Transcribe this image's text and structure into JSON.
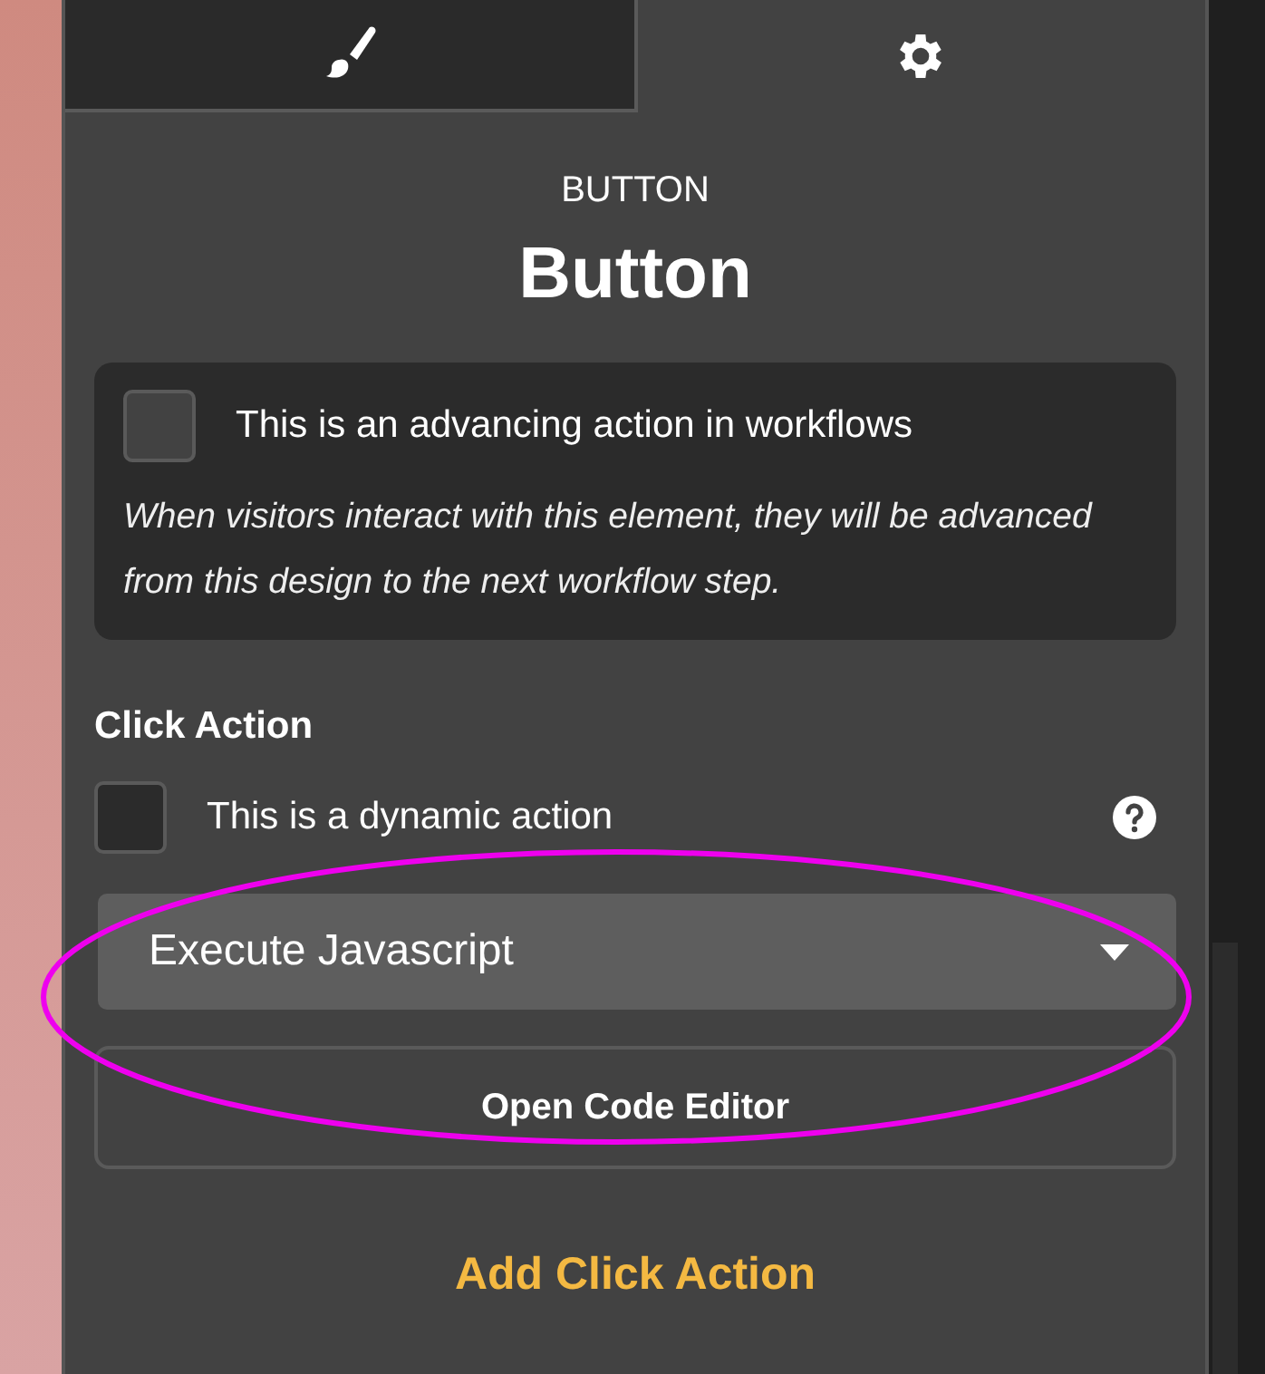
{
  "tabs": [
    {
      "kind": "brush",
      "selected": false
    },
    {
      "kind": "gear",
      "selected": true
    }
  ],
  "element_type": "BUTTON",
  "element_name": "Button",
  "workflow_card": {
    "checkbox": {
      "label": "This is an advancing action in workflows",
      "checked": false
    },
    "note": "When visitors interact with this element, they will be advanced from this design to the next workflow step."
  },
  "click_action": {
    "heading": "Click Action",
    "dynamic": {
      "label": "This is a dynamic action",
      "checked": false
    },
    "action_select": {
      "value": "Execute Javascript"
    },
    "editor_button": "Open Code Editor",
    "add_link": "Add Click Action"
  },
  "annotation": {
    "kind": "ellipse",
    "color": "#ee00ee"
  }
}
